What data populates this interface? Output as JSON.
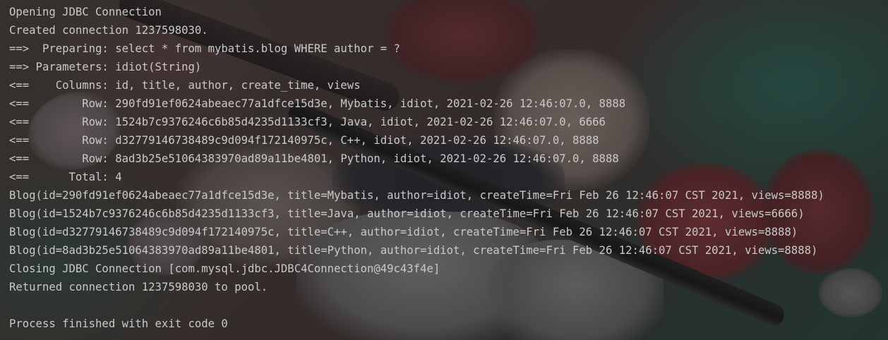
{
  "console": {
    "lines": [
      "Opening JDBC Connection",
      "Created connection 1237598030.",
      "==>  Preparing: select * from mybatis.blog WHERE author = ?",
      "==> Parameters: idiot(String)",
      "<==    Columns: id, title, author, create_time, views",
      "<==        Row: 290fd91ef0624abeaec77a1dfce15d3e, Mybatis, idiot, 2021-02-26 12:46:07.0, 8888",
      "<==        Row: 1524b7c9376246c6b85d4235d1133cf3, Java, idiot, 2021-02-26 12:46:07.0, 6666",
      "<==        Row: d32779146738489c9d094f172140975c, C++, idiot, 2021-02-26 12:46:07.0, 8888",
      "<==        Row: 8ad3b25e51064383970ad89a11be4801, Python, idiot, 2021-02-26 12:46:07.0, 8888",
      "<==      Total: 4",
      "Blog(id=290fd91ef0624abeaec77a1dfce15d3e, title=Mybatis, author=idiot, createTime=Fri Feb 26 12:46:07 CST 2021, views=8888)",
      "Blog(id=1524b7c9376246c6b85d4235d1133cf3, title=Java, author=idiot, createTime=Fri Feb 26 12:46:07 CST 2021, views=6666)",
      "Blog(id=d32779146738489c9d094f172140975c, title=C++, author=idiot, createTime=Fri Feb 26 12:46:07 CST 2021, views=8888)",
      "Blog(id=8ad3b25e51064383970ad89a11be4801, title=Python, author=idiot, createTime=Fri Feb 26 12:46:07 CST 2021, views=8888)",
      "Closing JDBC Connection [com.mysql.jdbc.JDBC4Connection@49c43f4e]",
      "Returned connection 1237598030 to pool.",
      "",
      "Process finished with exit code 0"
    ],
    "text_color": "#c9c9c9",
    "background_color": "#2b2b2b"
  }
}
